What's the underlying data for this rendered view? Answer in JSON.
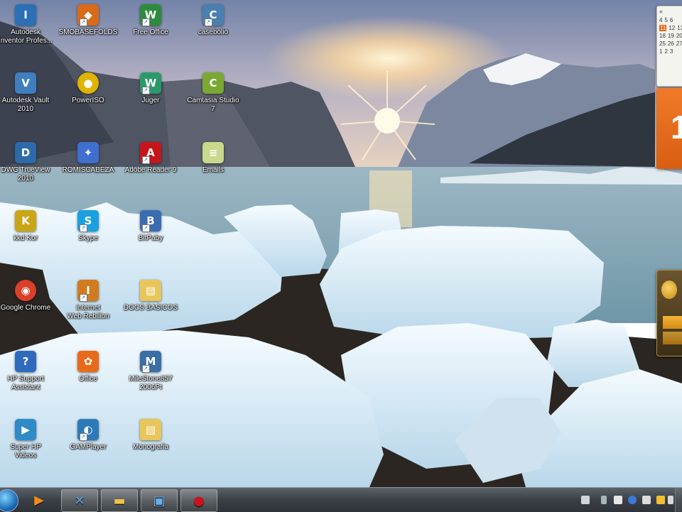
{
  "desktop": {
    "icons": [
      {
        "label": "Autodesk\nInventor Profes...",
        "glyph": "I",
        "color": "#2b6fb5",
        "shortcut": false
      },
      {
        "label": "SMOBASEFOLDS",
        "glyph": "◆",
        "color": "#d86a1a",
        "shortcut": true
      },
      {
        "label": "Free Office",
        "glyph": "W",
        "color": "#2e8b3e",
        "shortcut": true
      },
      {
        "label": "casebolio",
        "glyph": "C",
        "color": "#4a7fb0",
        "shortcut": true
      },
      {
        "label": "Autodesk Vault\n2010",
        "glyph": "V",
        "color": "#3f7fc0",
        "shortcut": false
      },
      {
        "label": "PowerISO",
        "glyph": "●",
        "color": "#e0b400",
        "shortcut": false
      },
      {
        "label": "Juger",
        "glyph": "W",
        "color": "#2a9a6a",
        "shortcut": true
      },
      {
        "label": "Camtasia Studio\n7",
        "glyph": "C",
        "color": "#7aa832",
        "shortcut": false
      },
      {
        "label": "DWG TrueView\n2010",
        "glyph": "D",
        "color": "#2d6aa8",
        "shortcut": false
      },
      {
        "label": "ROMISCABEZA",
        "glyph": "✦",
        "color": "#3f6fcf",
        "shortcut": false
      },
      {
        "label": "Adobe Reader 9",
        "glyph": "A",
        "color": "#c8141b",
        "shortcut": true
      },
      {
        "label": "Emails",
        "glyph": "≡",
        "color": "#c7d98a",
        "shortcut": false
      },
      {
        "label": "kkd Kor",
        "glyph": "K",
        "color": "#c9a617",
        "shortcut": false
      },
      {
        "label": "Skype",
        "glyph": "S",
        "color": "#1aa0e0",
        "shortcut": true
      },
      {
        "label": "BitPaby",
        "glyph": "B",
        "color": "#3a6cb0",
        "shortcut": true
      },
      {
        "label": "Google Chrome",
        "glyph": "◉",
        "color": "#d9402a",
        "shortcut": false
      },
      {
        "label": "Internet\nWeb Rebilion",
        "glyph": "I",
        "color": "#d07b20",
        "shortcut": true
      },
      {
        "label": "DOCS BASICOS",
        "glyph": "▤",
        "color": "#e8c65a",
        "shortcut": false
      },
      {
        "label": "HP Support\nAssistant",
        "glyph": "?",
        "color": "#2f6bbd",
        "shortcut": false
      },
      {
        "label": "Office",
        "glyph": "✿",
        "color": "#e86a1a",
        "shortcut": false
      },
      {
        "label": "MileStone857\n2006Pt",
        "glyph": "M",
        "color": "#3a6ea5",
        "shortcut": true
      },
      {
        "label": "Super HP\nVideos",
        "glyph": "▶",
        "color": "#2f8bc8",
        "shortcut": false
      },
      {
        "label": "GAMPlayer",
        "glyph": "◐",
        "color": "#2d7ab8",
        "shortcut": true
      },
      {
        "label": "Monografia",
        "glyph": "▤",
        "color": "#e8c65a",
        "shortcut": false
      }
    ]
  },
  "gadgets": {
    "calendar": {
      "header": "«",
      "rows": [
        [
          "4",
          "5",
          "6"
        ],
        [
          "11",
          "12",
          "13"
        ],
        [
          "18",
          "19",
          "20"
        ],
        [
          "25",
          "26",
          "27"
        ],
        [
          "1",
          "2",
          "3"
        ]
      ],
      "today": "11",
      "day_number": "1"
    }
  },
  "taskbar": {
    "start": "start-orb",
    "pinned": [
      {
        "name": "media-player",
        "glyph": "▶",
        "color": "#f08a1e"
      },
      {
        "name": "control-panel",
        "glyph": "✕",
        "color": "#5aa0d8"
      },
      {
        "name": "explorer",
        "glyph": "▬",
        "color": "#f0c24a"
      },
      {
        "name": "remote-desktop",
        "glyph": "▣",
        "color": "#6aaee8"
      },
      {
        "name": "recorder",
        "glyph": "●",
        "color": "#c8141b"
      }
    ]
  },
  "colors": {
    "sky_top": "#6a7ca6",
    "sky_glow": "#ffd39a",
    "water": "#8fb3c4",
    "ice": "#e8f2f8",
    "taskbar": "#3a4046"
  }
}
